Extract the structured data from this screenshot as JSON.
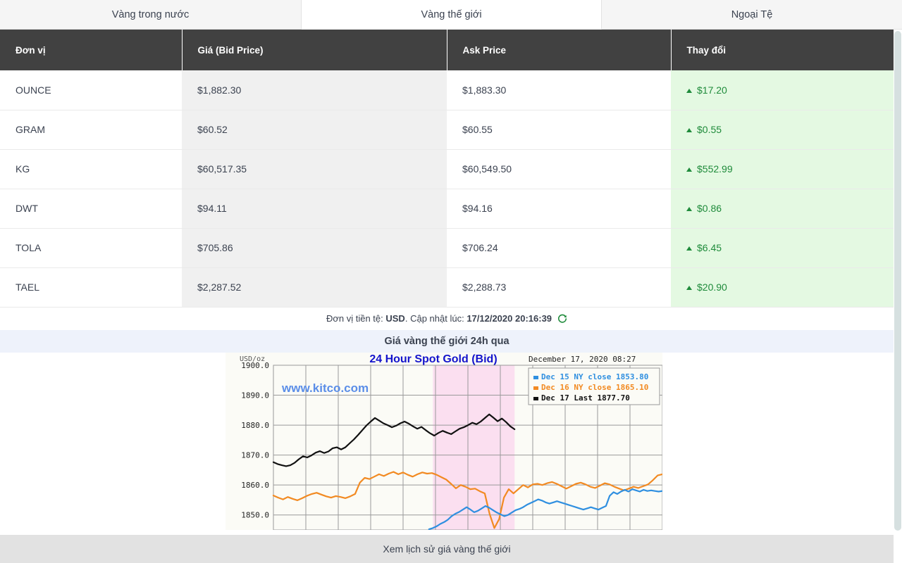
{
  "tabs": [
    {
      "label": "Vàng trong nước",
      "active": false
    },
    {
      "label": "Vàng thế giới",
      "active": true
    },
    {
      "label": "Ngoại Tệ",
      "active": false
    }
  ],
  "table": {
    "headers": [
      "Đơn vị",
      "Giá (Bid Price)",
      "Ask Price",
      "Thay đổi"
    ],
    "rows": [
      {
        "unit": "OUNCE",
        "bid": "$1,882.30",
        "ask": "$1,883.30",
        "change": "$17.20",
        "direction": "up"
      },
      {
        "unit": "GRAM",
        "bid": "$60.52",
        "ask": "$60.55",
        "change": "$0.55",
        "direction": "up"
      },
      {
        "unit": "KG",
        "bid": "$60,517.35",
        "ask": "$60,549.50",
        "change": "$552.99",
        "direction": "up"
      },
      {
        "unit": "DWT",
        "bid": "$94.11",
        "ask": "$94.16",
        "change": "$0.86",
        "direction": "up"
      },
      {
        "unit": "TOLA",
        "bid": "$705.86",
        "ask": "$706.24",
        "change": "$6.45",
        "direction": "up"
      },
      {
        "unit": "TAEL",
        "bid": "$2,287.52",
        "ask": "$2,288.73",
        "change": "$20.90",
        "direction": "up"
      }
    ]
  },
  "update": {
    "currency_label": "Đơn vị tiền tệ:",
    "currency_value": "USD",
    "separator": ".",
    "time_label": "Cập nhật lúc:",
    "time_value": "17/12/2020 20:16:39",
    "refresh_icon": "refresh-icon"
  },
  "banner": {
    "title": "Giá vàng thế giới 24h qua"
  },
  "footer": {
    "label": "Xem lịch sử giá vàng thế giới"
  },
  "colors": {
    "header_bg": "#414141",
    "change_positive": "#1f8b3b",
    "change_cell_bg": "#e4f9e2",
    "bid_cell_bg": "#f0f0f0",
    "banner_bg": "#eef2fb",
    "footer_bg": "#e2e2e2",
    "series_dec15": "#2f8fe0",
    "series_dec16": "#f28a22",
    "series_dec17": "#111111",
    "shaded_region": "#fbdff0"
  },
  "chart_data": {
    "type": "line",
    "title": "24 Hour Spot Gold (Bid)",
    "subtitle": "December 17, 2020 08:27",
    "watermark": "www.kitco.com",
    "ylabel": "USD/oz",
    "xlabel": "",
    "ylim": [
      1845,
      1900
    ],
    "yticks": [
      "1900.0",
      "1890.0",
      "1880.0",
      "1870.0",
      "1860.0",
      "1850.0"
    ],
    "ytick_values": [
      1900.0,
      1890.0,
      1880.0,
      1870.0,
      1860.0,
      1850.0
    ],
    "grid": true,
    "legend_position": "top-right",
    "legend": [
      {
        "label": "Dec 15 NY close 1853.80",
        "name": "Dec 15 NY close",
        "value": 1853.8,
        "color": "#2f8fe0"
      },
      {
        "label": "Dec 16 NY close 1865.10",
        "name": "Dec 16 NY close",
        "value": 1865.1,
        "color": "#f28a22"
      },
      {
        "label": "Dec 17 Last 1877.70",
        "name": "Dec 17 Last",
        "value": 1877.7,
        "color": "#111111"
      }
    ],
    "shaded_regions": [
      {
        "x_start_pct": 41.0,
        "x_end_pct": 62.0,
        "color": "#fbdff0"
      }
    ],
    "series": [
      {
        "name": "Dec 17 Last",
        "color": "#111111",
        "values": [
          1867.6,
          1867.0,
          1866.6,
          1866.3,
          1866.6,
          1867.4,
          1868.6,
          1869.6,
          1869.2,
          1869.9,
          1870.8,
          1871.3,
          1870.7,
          1871.2,
          1872.3,
          1872.6,
          1871.9,
          1872.6,
          1873.9,
          1875.2,
          1876.7,
          1878.3,
          1879.9,
          1881.2,
          1882.4,
          1881.5,
          1880.6,
          1880.0,
          1879.3,
          1879.8,
          1880.6,
          1881.2,
          1880.5,
          1879.6,
          1878.8,
          1879.4,
          1878.3,
          1877.3,
          1876.5,
          1877.4,
          1878.1,
          1877.5,
          1877.0,
          1877.9,
          1878.8,
          1879.3,
          1880.0,
          1880.8,
          1880.3,
          1881.2,
          1882.4,
          1883.6,
          1882.5,
          1881.3,
          1882.2,
          1881.0,
          1879.6,
          1878.6
        ]
      },
      {
        "name": "Dec 16 NY close",
        "color": "#f28a22",
        "values": [
          1856.5,
          1855.8,
          1855.2,
          1856.0,
          1855.4,
          1854.9,
          1855.6,
          1856.4,
          1857.0,
          1857.4,
          1856.8,
          1856.2,
          1855.8,
          1856.3,
          1856.0,
          1855.6,
          1856.2,
          1857.0,
          1860.8,
          1862.4,
          1862.0,
          1862.8,
          1863.6,
          1863.0,
          1863.8,
          1864.4,
          1863.6,
          1864.2,
          1863.4,
          1862.8,
          1863.6,
          1864.2,
          1863.8,
          1864.0,
          1863.4,
          1862.6,
          1861.8,
          1860.4,
          1858.9,
          1860.0,
          1859.4,
          1858.6,
          1858.8,
          1857.9,
          1857.2,
          1850.4,
          1845.6,
          1848.6,
          1855.8,
          1858.6,
          1857.2,
          1858.6,
          1860.0,
          1859.2,
          1860.2,
          1860.4,
          1860.0,
          1860.6,
          1861.0,
          1860.4,
          1859.6,
          1858.8,
          1859.6,
          1860.4,
          1860.8,
          1860.2,
          1859.4,
          1859.0,
          1859.8,
          1860.6,
          1860.2,
          1859.4,
          1858.8,
          1858.2,
          1858.8,
          1859.4,
          1859.0,
          1859.6,
          1860.2,
          1861.6,
          1863.2,
          1863.6
        ]
      },
      {
        "name": "Dec 15 NY close",
        "color": "#2f8fe0",
        "values": [
          1845.2,
          1845.6,
          1846.2,
          1847.0,
          1847.6,
          1848.4,
          1849.6,
          1850.4,
          1851.0,
          1851.8,
          1852.6,
          1851.8,
          1850.9,
          1851.4,
          1852.2,
          1853.0,
          1852.4,
          1851.6,
          1850.8,
          1850.2,
          1849.6,
          1850.0,
          1850.8,
          1851.6,
          1852.0,
          1852.6,
          1853.4,
          1854.0,
          1854.6,
          1855.2,
          1854.8,
          1854.2,
          1853.8,
          1854.2,
          1854.6,
          1854.2,
          1853.8,
          1853.4,
          1853.0,
          1852.6,
          1852.2,
          1851.8,
          1852.2,
          1852.6,
          1852.2,
          1851.8,
          1852.4,
          1853.0,
          1856.4,
          1857.6,
          1857.0,
          1857.8,
          1858.4,
          1857.8,
          1858.6,
          1858.2,
          1857.8,
          1858.4,
          1858.0,
          1858.2,
          1858.0,
          1857.8,
          1858.0
        ]
      }
    ]
  }
}
